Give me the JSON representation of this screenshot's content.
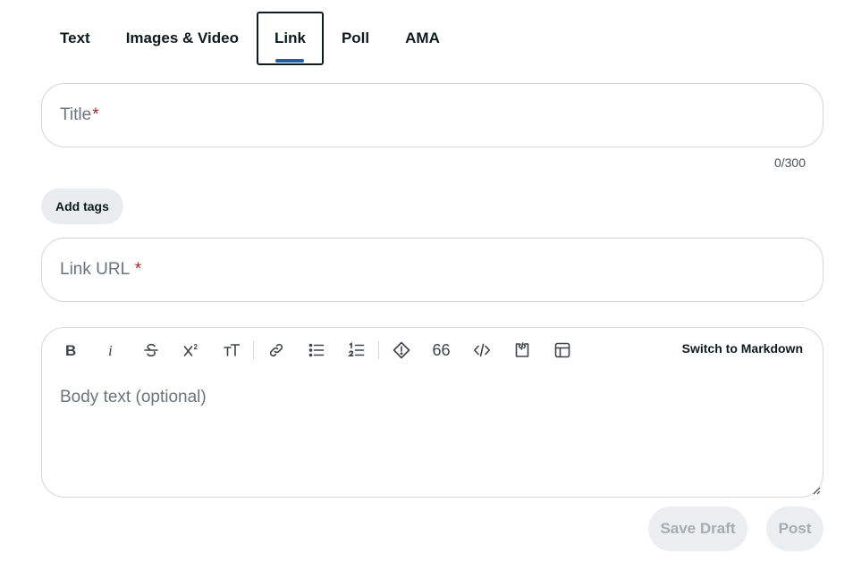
{
  "tabs": [
    {
      "label": "Text"
    },
    {
      "label": "Images & Video"
    },
    {
      "label": "Link"
    },
    {
      "label": "Poll"
    },
    {
      "label": "AMA"
    }
  ],
  "active_tab": "Link",
  "title_field": {
    "placeholder": "Title",
    "required_mark": "*",
    "counter": "0/300"
  },
  "tags": {
    "label": "Add tags"
  },
  "url_field": {
    "placeholder": "Link URL ",
    "required_mark": "*"
  },
  "editor": {
    "toolbar": [
      "bold-icon",
      "italic-icon",
      "strikethrough-icon",
      "superscript-icon",
      "heading-icon",
      "link-icon",
      "bullet-list-icon",
      "numbered-list-icon",
      "spoiler-icon",
      "quote-icon",
      "code-icon",
      "code-block-icon",
      "table-icon"
    ],
    "quote_glyph": "66",
    "switch_label": "Switch to Markdown",
    "body_placeholder": "Body text (optional)"
  },
  "actions": {
    "save_draft": "Save Draft",
    "post": "Post"
  },
  "colors": {
    "accent": "#1f5fa8",
    "required": "#9b2a2a"
  }
}
